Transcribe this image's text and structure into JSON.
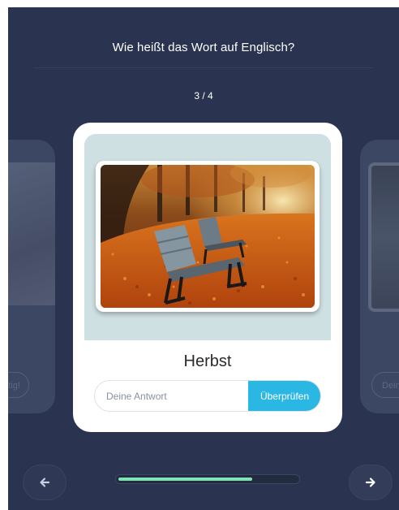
{
  "header": {
    "question": "Wie heißt das Wort auf Englisch?",
    "counter": "3 / 4"
  },
  "card": {
    "image_icon": "autumn-bench-photo",
    "word": "Herbst",
    "answer": {
      "value": "",
      "placeholder": "Deine Antwort"
    },
    "check_label": "Überprüfen"
  },
  "previous_card": {
    "feedback_partial": "ichtig!"
  },
  "next_card": {
    "placeholder_partial": "Dein"
  },
  "navigation": {
    "prev_icon": "arrow-left-icon",
    "next_icon": "arrow-right-icon"
  },
  "progress": {
    "fraction": 0.75
  },
  "colors": {
    "background": "#2a3450",
    "accent": "#2bb7e3",
    "progress": "#7fe3b8",
    "card": "#ffffff"
  }
}
